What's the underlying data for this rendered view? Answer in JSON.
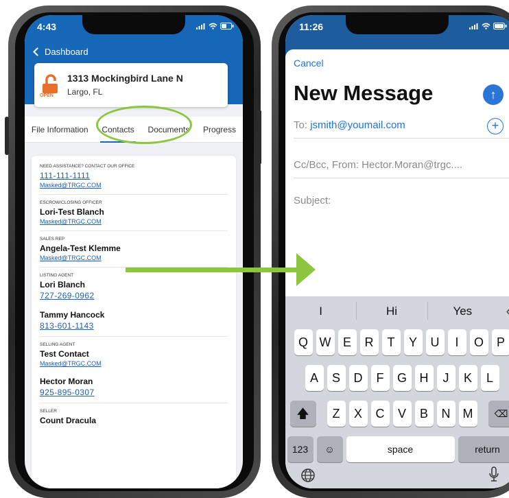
{
  "left_phone": {
    "status_time": "4:43",
    "back_label": "Dashboard",
    "property": {
      "lock_status": "OPEN",
      "address": "1313 Mockingbird Lane N",
      "city": "Largo, FL"
    },
    "tabs": [
      {
        "label": "File Information"
      },
      {
        "label": "Contacts"
      },
      {
        "label": "Documents"
      },
      {
        "label": "Progress"
      }
    ],
    "contacts": {
      "office": {
        "label": "NEED ASSISTANCE? CONTACT OUR OFFICE",
        "phone": "111-111-1111",
        "email": "Masked@TRGC.COM"
      },
      "escrow": {
        "label": "ESCROW/CLOSING OFFICER",
        "name": "Lori-Test Blanch",
        "email": "Masked@TRGC.COM"
      },
      "sales_rep": {
        "label": "SALES REP",
        "name": "Angela-Test Klemme",
        "email": "Masked@TRGC.COM"
      },
      "listing_agent": {
        "label": "LISTING AGENT",
        "people": [
          {
            "name": "Lori Blanch",
            "phone": "727-269-0962"
          },
          {
            "name": "Tammy Hancock",
            "phone": "813-601-1143"
          }
        ]
      },
      "selling_agent": {
        "label": "SELLING AGENT",
        "name": "Test Contact",
        "email": "Masked@TRGC.COM",
        "name2": "Hector Moran",
        "phone2": "925-895-0307"
      },
      "seller": {
        "label": "SELLER",
        "name": "Count Dracula"
      }
    }
  },
  "right_phone": {
    "status_time": "11:26",
    "cancel_label": "Cancel",
    "title": "New Message",
    "to_label": "To:",
    "to_value": "jsmith@youmail.com",
    "ccbcc_text": "Cc/Bcc, From: Hector.Moran@trgc....",
    "subject_label": "Subject:",
    "predictions": [
      "I",
      "Hi",
      "Yes"
    ],
    "keyboard": {
      "row1": [
        "Q",
        "W",
        "E",
        "R",
        "T",
        "Y",
        "U",
        "I",
        "O",
        "P"
      ],
      "row2": [
        "A",
        "S",
        "D",
        "F",
        "G",
        "H",
        "J",
        "K",
        "L"
      ],
      "row3": [
        "Z",
        "X",
        "C",
        "V",
        "B",
        "N",
        "M"
      ],
      "num_label": "123",
      "space_label": "space",
      "return_label": "return"
    }
  },
  "colors": {
    "app_blue": "#1767b8",
    "annotation_green": "#8cc63f",
    "ios_blue": "#1a73e8",
    "lock_orange": "#e8702a"
  }
}
